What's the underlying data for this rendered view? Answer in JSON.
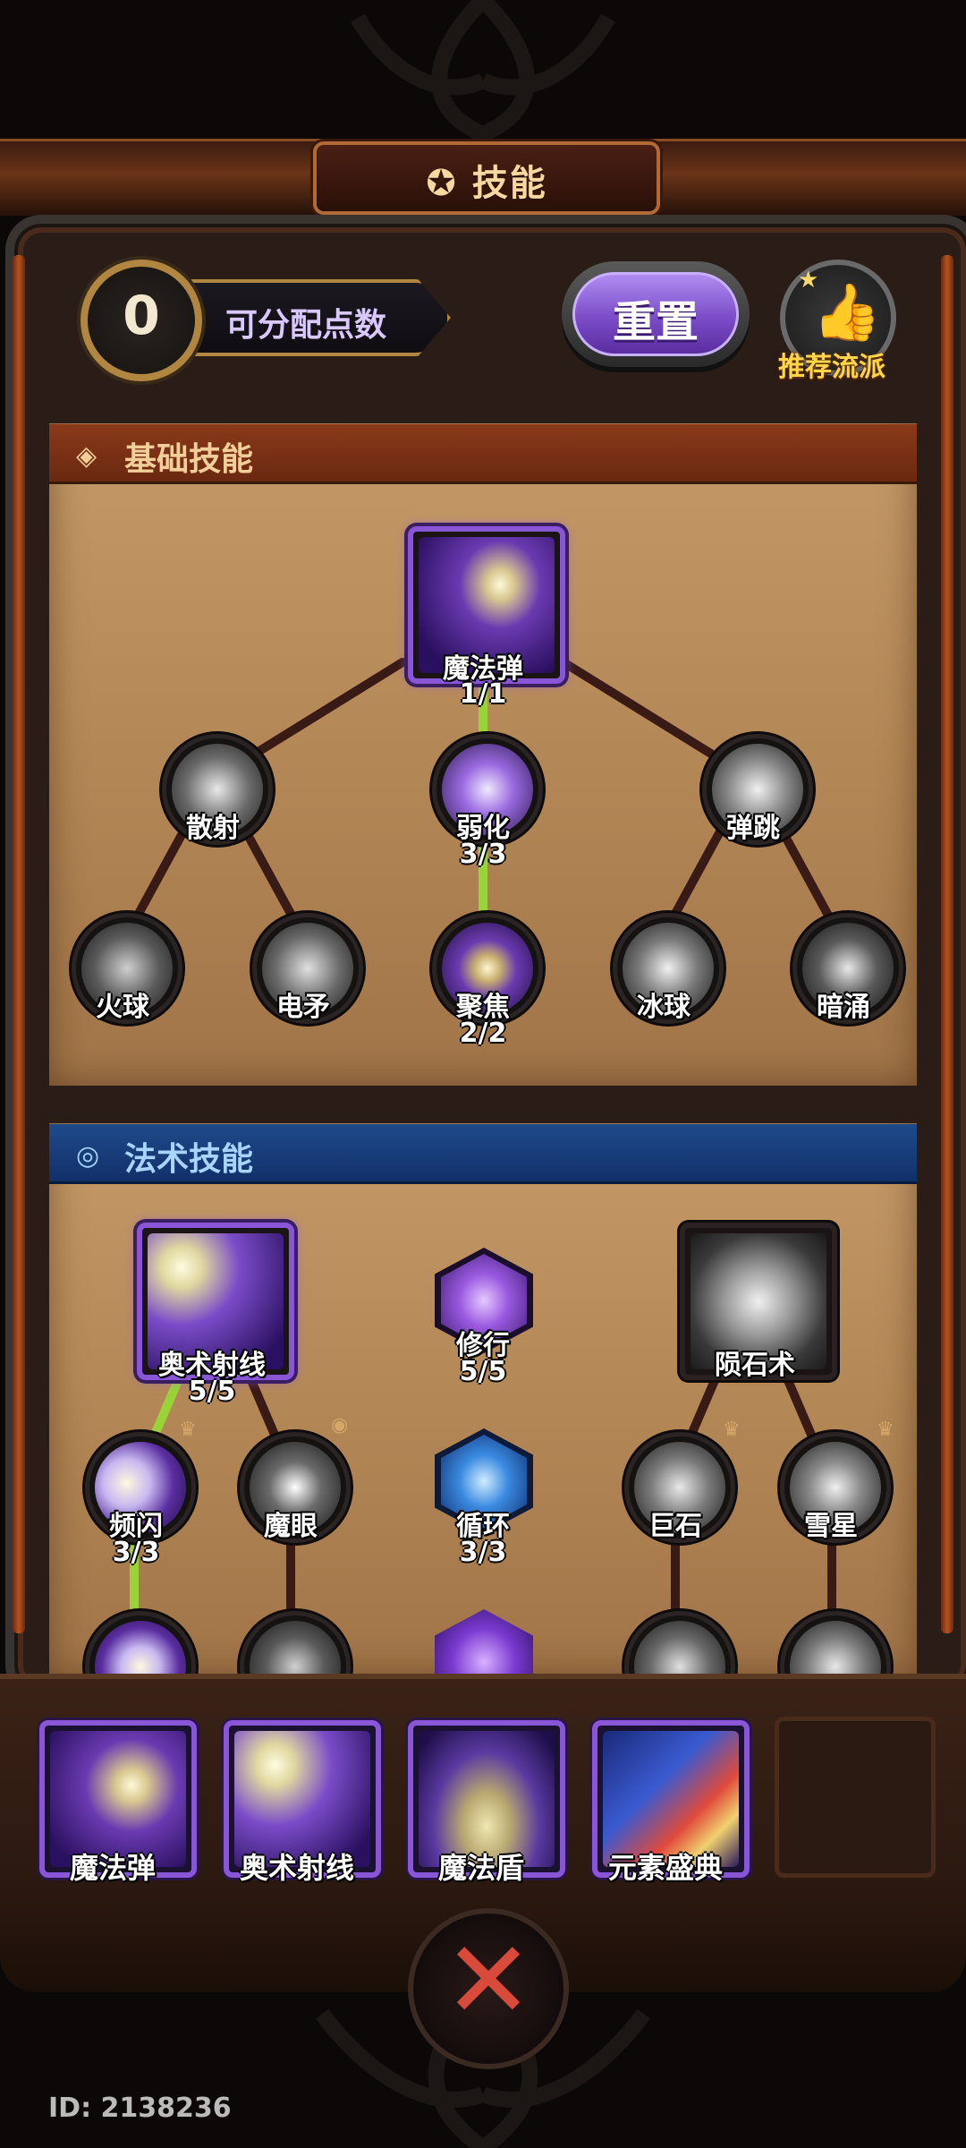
{
  "header": {
    "title": "技能",
    "title_icon": "pentagram-icon"
  },
  "skill_points": {
    "value": "0",
    "label": "可分配点数"
  },
  "reset_button": {
    "label": "重置"
  },
  "recommend_button": {
    "label": "推荐流派",
    "icon": "thumbs-up-icon"
  },
  "basic_section": {
    "title": "基础技能",
    "icon": "diamond-icon",
    "nodes": [
      {
        "name": "魔法弹",
        "count": "1/1",
        "active": true
      },
      {
        "name": "散射",
        "count": ""
      },
      {
        "name": "弱化",
        "count": "3/3",
        "active": true
      },
      {
        "name": "弹跳",
        "count": ""
      },
      {
        "name": "火球",
        "count": ""
      },
      {
        "name": "电矛",
        "count": ""
      },
      {
        "name": "聚焦",
        "count": "2/2",
        "active": true
      },
      {
        "name": "冰球",
        "count": ""
      },
      {
        "name": "暗涌",
        "count": ""
      }
    ]
  },
  "spell_section": {
    "title": "法术技能",
    "icon": "swirl-icon",
    "nodes": [
      {
        "name": "奥术射线",
        "count": "5/5",
        "active": true
      },
      {
        "name": "修行",
        "count": "5/5",
        "active": true
      },
      {
        "name": "陨石术",
        "count": ""
      },
      {
        "name": "频闪",
        "count": "3/3",
        "active": true
      },
      {
        "name": "魔眼",
        "count": ""
      },
      {
        "name": "循环",
        "count": "3/3",
        "active": true
      },
      {
        "name": "巨石",
        "count": ""
      },
      {
        "name": "雪星",
        "count": ""
      }
    ]
  },
  "equipped": {
    "slots": [
      {
        "name": "魔法弹"
      },
      {
        "name": "奥术射线"
      },
      {
        "name": "魔法盾"
      },
      {
        "name": "元素盛典"
      }
    ],
    "empty_slot": "empty-slot"
  },
  "close_button": {
    "icon": "crossed-swords-close-icon"
  },
  "footer": {
    "player_id": "ID: 2138236"
  },
  "colors": {
    "accent_purple": "#8a56d8",
    "basic_header": "#7a3216",
    "spell_header": "#163a7a",
    "active_link": "#9ad23a",
    "inactive_link": "#3a1a14",
    "gold": "#ffd54a"
  }
}
